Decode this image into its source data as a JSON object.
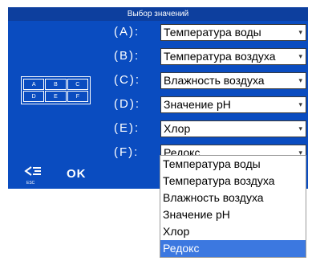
{
  "window": {
    "title": "Выбор значений"
  },
  "grid_icon": {
    "cells": [
      "A",
      "B",
      "C",
      "D",
      "E",
      "F"
    ]
  },
  "rows": [
    {
      "label": "(A):",
      "value": "Температура воды"
    },
    {
      "label": "(B):",
      "value": "Температура воздуха"
    },
    {
      "label": "(C):",
      "value": "Влажность воздуха"
    },
    {
      "label": "(D):",
      "value": "Значение pH"
    },
    {
      "label": "(E):",
      "value": "Хлор"
    },
    {
      "label": "(F):",
      "value": "Редокс"
    }
  ],
  "footer": {
    "esc_label": "ESC",
    "ok_label": "OK"
  },
  "dropdown": {
    "options": [
      "Температура воды",
      "Температура воздуха",
      "Влажность воздуха",
      "Значение pH",
      "Хлор",
      "Редокс"
    ],
    "selected": "Редокс"
  },
  "colors": {
    "panel": "#0a4cc0",
    "titlebar": "#0d3f9e",
    "highlight": "#3c78e0"
  }
}
